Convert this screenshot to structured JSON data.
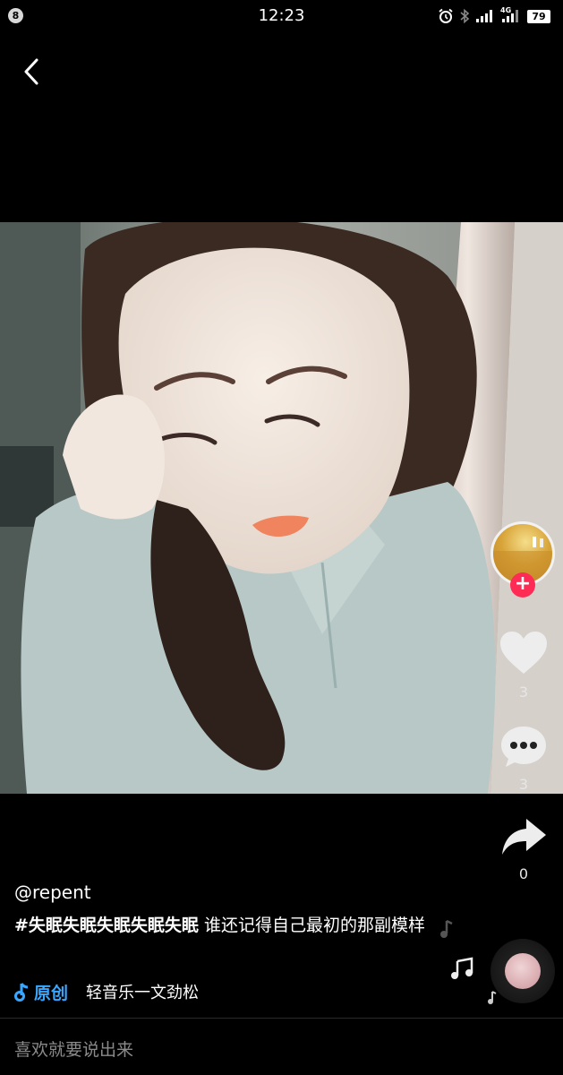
{
  "status_bar": {
    "notification_count": "8",
    "time": "12:23",
    "network_label": "4G",
    "battery_level": "79",
    "icons": [
      "alarm-icon",
      "bluetooth-icon",
      "signal-icon",
      "signal-4g-icon"
    ]
  },
  "back": {
    "icon": "chevron-left-icon"
  },
  "actions": {
    "like_count": "3",
    "comment_count": "3",
    "share_count": "0",
    "follow_plus": "+"
  },
  "post": {
    "username": "@repent",
    "hashtag": "#失眠失眠失眠失眠失眠",
    "caption_text": " 谁还记得自己最初的那副模样",
    "original_label": "原创",
    "music_title": "轻音乐一文劲松"
  },
  "comment_box": {
    "placeholder": "喜欢就要说出来"
  },
  "colors": {
    "background": "#000000",
    "accent_pink": "#fe2c55",
    "accent_blue": "#3aa7ff"
  }
}
